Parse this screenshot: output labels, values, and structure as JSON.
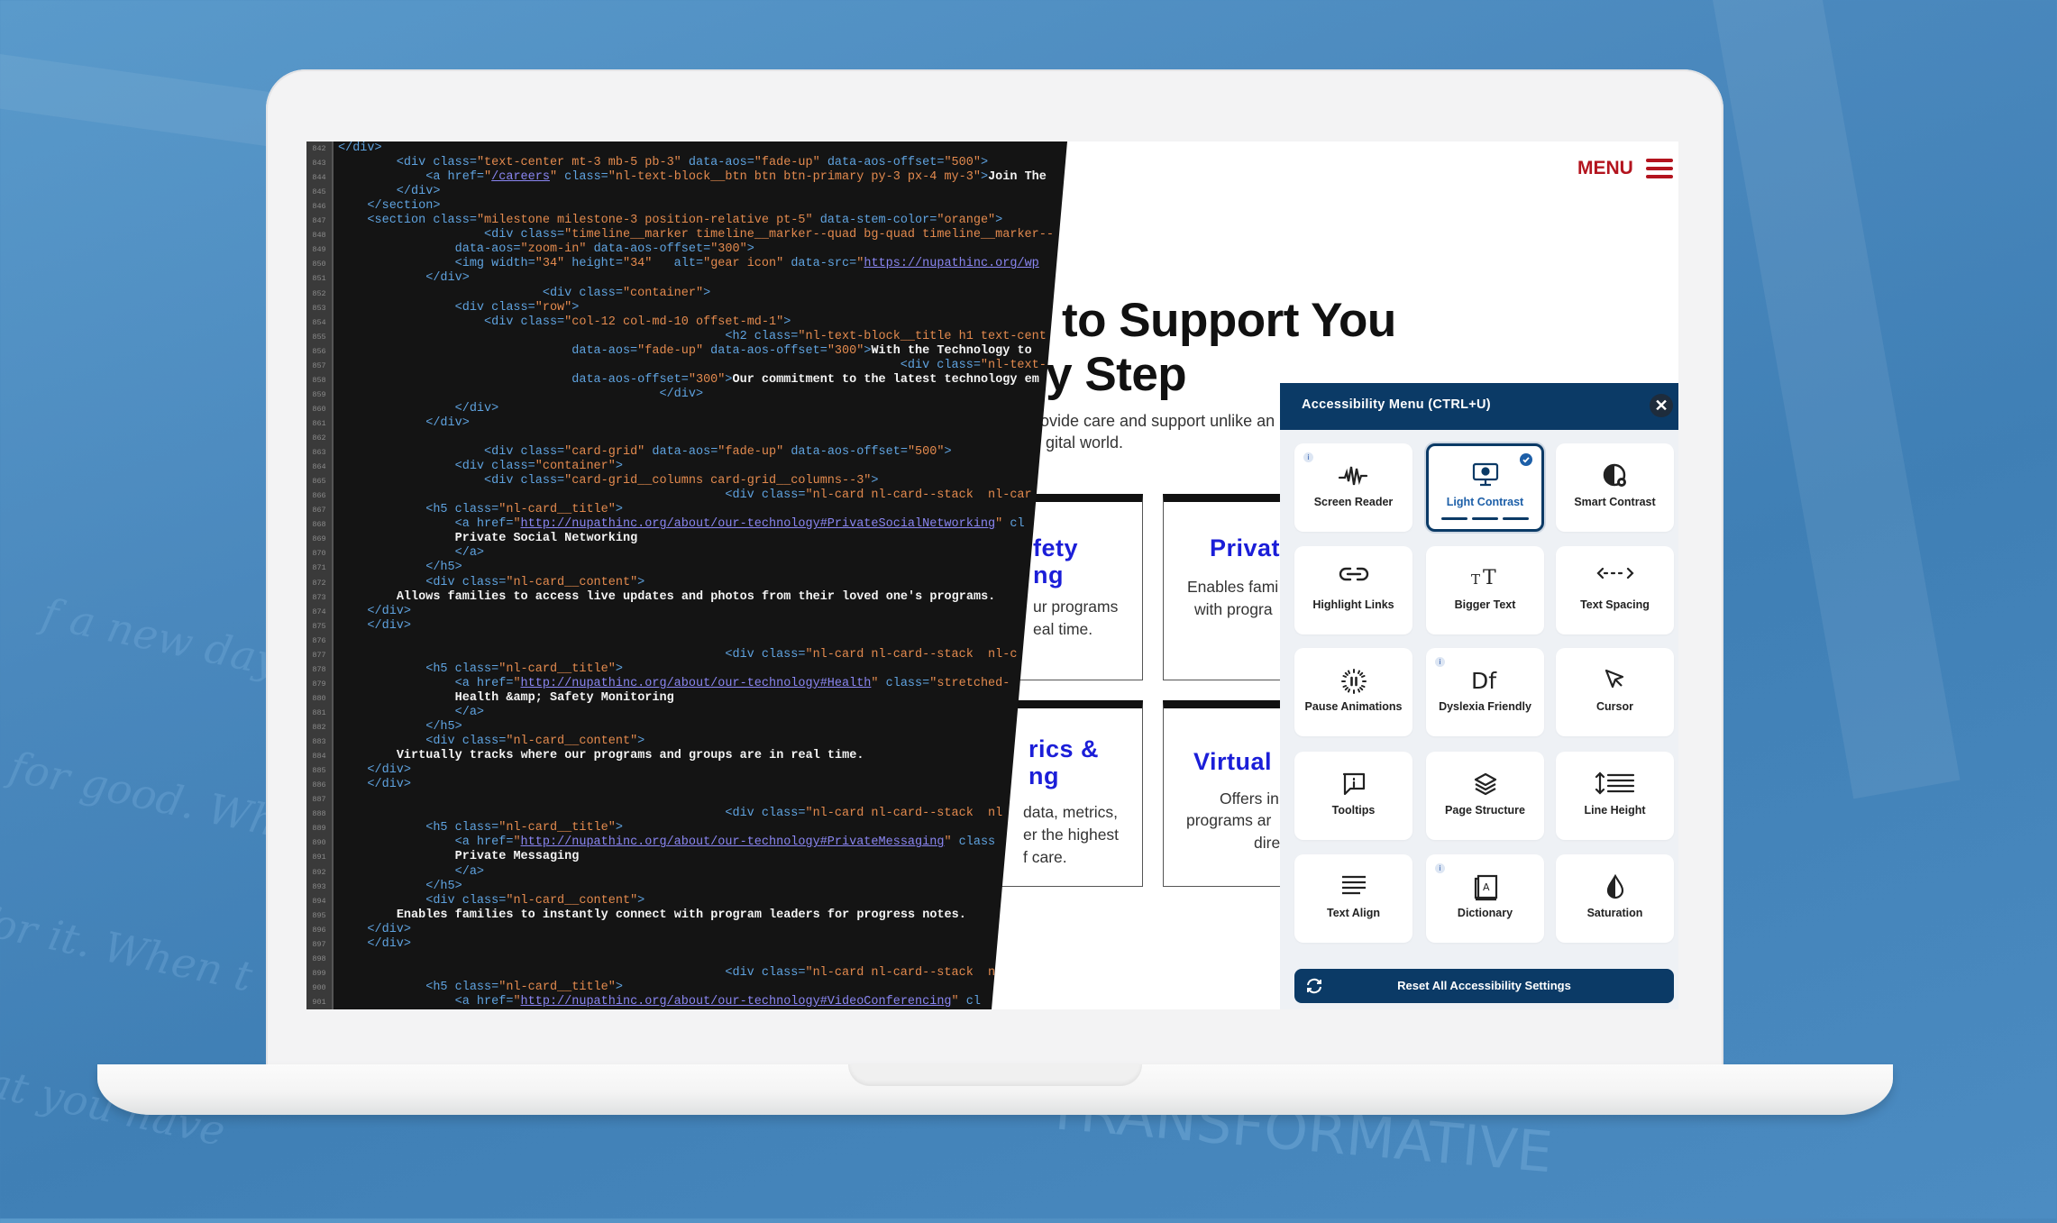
{
  "background": {
    "script_lines": [
      "f a new day. You",
      "for good. What g",
      "for it. When t",
      "that you have"
    ],
    "banner_word": "TRANSFORMATIVE",
    "colors": {
      "primary": "#4a88bd"
    }
  },
  "website": {
    "menu_label": "MENU",
    "headline": [
      "to Support You",
      "ry Step"
    ],
    "intro": [
      "ovide care and support unlike an",
      "gital world."
    ],
    "cards": [
      {
        "title": [
          "fety",
          "ng"
        ],
        "body": [
          "ur programs",
          "eal time."
        ]
      },
      {
        "title": [
          "Privat"
        ],
        "body": [
          "Enables fami",
          "with progra"
        ]
      },
      {
        "title": [
          "rics &",
          "ng"
        ],
        "body": [
          "data, metrics,",
          "er the highest",
          "f care."
        ]
      },
      {
        "title": [
          "Virtual"
        ],
        "body": [
          "Offers in",
          "programs ar",
          "dire"
        ]
      }
    ],
    "colors": {
      "menu": "#b3141e",
      "card_title": "#1b1ed8"
    }
  },
  "code_editor": {
    "lines": [
      {
        "n": "842",
        "text": "</div>"
      },
      {
        "n": "843",
        "text": "        <div class=\"text-center mt-3 mb-5 pb-3\" data-aos=\"fade-up\" data-aos-offset=\"500\">"
      },
      {
        "n": "844",
        "text": "            <a href=\"/careers\" class=\"nl-text-block__btn btn btn-primary py-3 px-4 my-3\">Join The"
      },
      {
        "n": "845",
        "text": "        </div>"
      },
      {
        "n": "846",
        "text": "    </section>"
      },
      {
        "n": "847",
        "text": "    <section class=\"milestone milestone-3 position-relative pt-5\" data-stem-color=\"orange\">"
      },
      {
        "n": "848",
        "text": "                    <div class=\"timeline__marker timeline__marker--quad bg-quad timeline__marker--"
      },
      {
        "n": "849",
        "text": "                data-aos=\"zoom-in\" data-aos-offset=\"300\">"
      },
      {
        "n": "850",
        "text": "                <img width=\"34\" height=\"34\"   alt=\"gear icon\" data-src=\"https://nupathinc.org/wp-"
      },
      {
        "n": "851",
        "text": "            </div>"
      },
      {
        "n": "852",
        "text": "                            <div class=\"container\">"
      },
      {
        "n": "853",
        "text": "                <div class=\"row\">"
      },
      {
        "n": "854",
        "text": "                    <div class=\"col-12 col-md-10 offset-md-1\">"
      },
      {
        "n": "855",
        "text": "                                                     <h2 class=\"nl-text-block__title h1 text-cent"
      },
      {
        "n": "856",
        "text": "                                data-aos=\"fade-up\" data-aos-offset=\"300\">With the Technology to"
      },
      {
        "n": "857",
        "text": "                                                                             <div class=\"nl-text-"
      },
      {
        "n": "858",
        "text": "                                data-aos-offset=\"300\">Our commitment to the latest technology em"
      },
      {
        "n": "859",
        "text": "                                            </div>"
      },
      {
        "n": "860",
        "text": "                </div>"
      },
      {
        "n": "861",
        "text": "            </div>"
      },
      {
        "n": "862",
        "text": ""
      },
      {
        "n": "863",
        "text": "                    <div class=\"card-grid\" data-aos=\"fade-up\" data-aos-offset=\"500\">"
      },
      {
        "n": "864",
        "text": "                <div class=\"container\">"
      },
      {
        "n": "865",
        "text": "                    <div class=\"card-grid__columns card-grid__columns--3\">"
      },
      {
        "n": "866",
        "text": "                                                     <div class=\"nl-card nl-card--stack  nl-car"
      },
      {
        "n": "867",
        "text": "            <h5 class=\"nl-card__title\">"
      },
      {
        "n": "868",
        "text": "                <a href=\"http://nupathinc.org/about/our-technology#PrivateSocialNetworking\" cl"
      },
      {
        "n": "869",
        "text": "                Private Social Networking"
      },
      {
        "n": "870",
        "text": "                </a>"
      },
      {
        "n": "871",
        "text": "            </h5>"
      },
      {
        "n": "872",
        "text": "            <div class=\"nl-card__content\">"
      },
      {
        "n": "873",
        "text": "        Allows families to access live updates and photos from their loved one's programs."
      },
      {
        "n": "874",
        "text": "    </div>"
      },
      {
        "n": "875",
        "text": "    </div>"
      },
      {
        "n": "876",
        "text": ""
      },
      {
        "n": "877",
        "text": "                                                     <div class=\"nl-card nl-card--stack  nl-c"
      },
      {
        "n": "878",
        "text": "            <h5 class=\"nl-card__title\">"
      },
      {
        "n": "879",
        "text": "                <a href=\"http://nupathinc.org/about/our-technology#Health\" class=\"stretched-"
      },
      {
        "n": "880",
        "text": "                Health &amp; Safety Monitoring"
      },
      {
        "n": "881",
        "text": "                </a>"
      },
      {
        "n": "882",
        "text": "            </h5>"
      },
      {
        "n": "883",
        "text": "            <div class=\"nl-card__content\">"
      },
      {
        "n": "884",
        "text": "        Virtually tracks where our programs and groups are in real time."
      },
      {
        "n": "885",
        "text": "    </div>"
      },
      {
        "n": "886",
        "text": "    </div>"
      },
      {
        "n": "887",
        "text": ""
      },
      {
        "n": "888",
        "text": "                                                     <div class=\"nl-card nl-card--stack  nl"
      },
      {
        "n": "889",
        "text": "            <h5 class=\"nl-card__title\">"
      },
      {
        "n": "890",
        "text": "                <a href=\"http://nupathinc.org/about/our-technology#PrivateMessaging\" class"
      },
      {
        "n": "891",
        "text": "                Private Messaging"
      },
      {
        "n": "892",
        "text": "                </a>"
      },
      {
        "n": "893",
        "text": "            </h5>"
      },
      {
        "n": "894",
        "text": "            <div class=\"nl-card__content\">"
      },
      {
        "n": "895",
        "text": "        Enables families to instantly connect with program leaders for progress notes."
      },
      {
        "n": "896",
        "text": "    </div>"
      },
      {
        "n": "897",
        "text": "    </div>"
      },
      {
        "n": "898",
        "text": ""
      },
      {
        "n": "899",
        "text": "                                                     <div class=\"nl-card nl-card--stack  n"
      },
      {
        "n": "900",
        "text": "            <h5 class=\"nl-card__title\">"
      },
      {
        "n": "901",
        "text": "                <a href=\"http://nupathinc.org/about/our-technology#VideoConferencing\" cl"
      }
    ],
    "colors": {
      "tag": "#5fa3e0",
      "string": "#e38a4e",
      "link": "#8a86f2",
      "background": "#141414"
    }
  },
  "accessibility_menu": {
    "title": "Accessibility Menu (CTRL+U)",
    "close_icon": "close-icon",
    "tiles": [
      {
        "label": "Screen Reader",
        "icon": "waveform",
        "info": true,
        "active": false
      },
      {
        "label": "Light Contrast",
        "icon": "monitor",
        "info": false,
        "active": true
      },
      {
        "label": "Smart Contrast",
        "icon": "contrast-gear",
        "info": false,
        "active": false
      },
      {
        "label": "Highlight Links",
        "icon": "link",
        "info": false,
        "active": false
      },
      {
        "label": "Bigger Text",
        "icon": "text-size",
        "info": false,
        "active": false
      },
      {
        "label": "Text Spacing",
        "icon": "arrows-horizontal",
        "info": false,
        "active": false
      },
      {
        "label": "Pause Animations",
        "icon": "pause-spinner",
        "info": false,
        "active": false
      },
      {
        "label": "Dyslexia Friendly",
        "icon": "df-letters",
        "info": true,
        "active": false
      },
      {
        "label": "Cursor",
        "icon": "cursor",
        "info": false,
        "active": false
      },
      {
        "label": "Tooltips",
        "icon": "tooltip",
        "info": false,
        "active": false
      },
      {
        "label": "Page Structure",
        "icon": "layers",
        "info": false,
        "active": false
      },
      {
        "label": "Line Height",
        "icon": "line-height",
        "info": false,
        "active": false
      },
      {
        "label": "Text Align",
        "icon": "align-lines",
        "info": false,
        "active": false
      },
      {
        "label": "Dictionary",
        "icon": "book",
        "info": true,
        "active": false
      },
      {
        "label": "Saturation",
        "icon": "drop",
        "info": false,
        "active": false
      }
    ],
    "reset_label": "Reset All Accessibility Settings",
    "info_glyph": "i",
    "colors": {
      "header": "#0b3a66",
      "active_label": "#1d5fa8",
      "panel": "#eef1f5"
    }
  }
}
